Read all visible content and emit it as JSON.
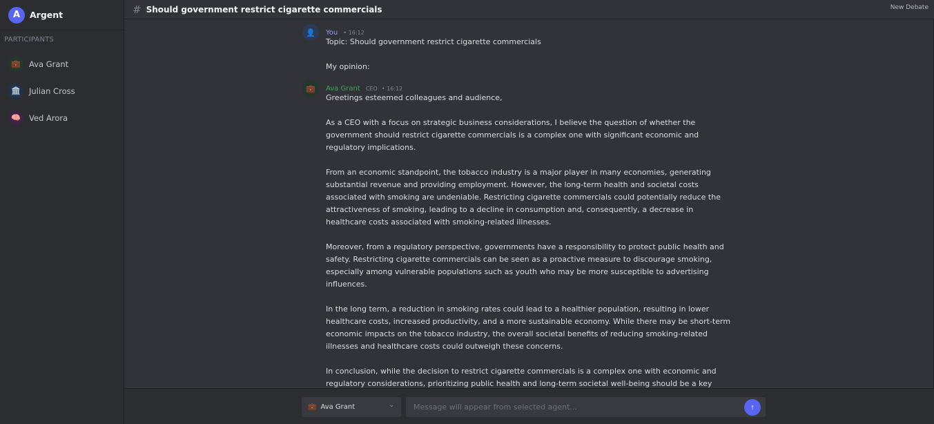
{
  "app": {
    "name": "Argent",
    "initial": "A",
    "accent": "#5865f2"
  },
  "sidebar": {
    "section_label": "PARTICIPANTS",
    "participants": [
      {
        "name": "Ava Grant",
        "icon": "briefcase-icon",
        "glyph": "💼",
        "color": "#2f4a3a"
      },
      {
        "name": "Julian Cross",
        "icon": "bank-icon",
        "glyph": "🏛️",
        "color": "#2d3f55"
      },
      {
        "name": "Ved Arora",
        "icon": "brain-icon",
        "glyph": "🧠",
        "color": "#4a2f4f"
      }
    ]
  },
  "header": {
    "title": "Should government restrict cigarette commercials",
    "new_debate": "New Debate"
  },
  "messages": [
    {
      "author": "You",
      "role": "",
      "time": "• 16:12",
      "icon": "user-icon",
      "glyph": "👤",
      "author_color": "#949cf7",
      "paragraphs": [
        "Topic: Should government restrict cigarette commercials",
        "My opinion:"
      ]
    },
    {
      "author": "Ava Grant",
      "role": "CEO",
      "time": "• 16:12",
      "icon": "briefcase-icon",
      "glyph": "💼",
      "author_color": "#3ba55d",
      "paragraphs": [
        "Greetings esteemed colleagues and audience,",
        "As a CEO with a focus on strategic business considerations, I believe the question of whether the government should restrict cigarette commercials is a complex one with significant economic and regulatory implications.",
        "From an economic standpoint, the tobacco industry is a major player in many economies, generating substantial revenue and providing employment. However, the long-term health and societal costs associated with smoking are undeniable. Restricting cigarette commercials could potentially reduce the attractiveness of smoking, leading to a decline in consumption and, consequently, a decrease in healthcare costs associated with smoking-related illnesses.",
        "Moreover, from a regulatory perspective, governments have a responsibility to protect public health and safety. Restricting cigarette commercials can be seen as a proactive measure to discourage smoking, especially among vulnerable populations such as youth who may be more susceptible to advertising influences.",
        "In the long term, a reduction in smoking rates could lead to a healthier population, resulting in lower healthcare costs, increased productivity, and a more sustainable economy. While there may be short-term economic impacts on the tobacco industry, the overall societal benefits of reducing smoking-related illnesses and healthcare costs could outweigh these concerns.",
        "In conclusion, while the decision to restrict cigarette commercials is a complex one with economic and regulatory considerations, prioritizing public health and long-term societal well-being should be a key factor"
      ]
    }
  ],
  "composer": {
    "selected_agent": "Ava Grant",
    "selected_agent_glyph": "💼",
    "placeholder": "Message will appear from selected agent...",
    "send_glyph": "↑",
    "chevron_glyph": "⌄"
  }
}
